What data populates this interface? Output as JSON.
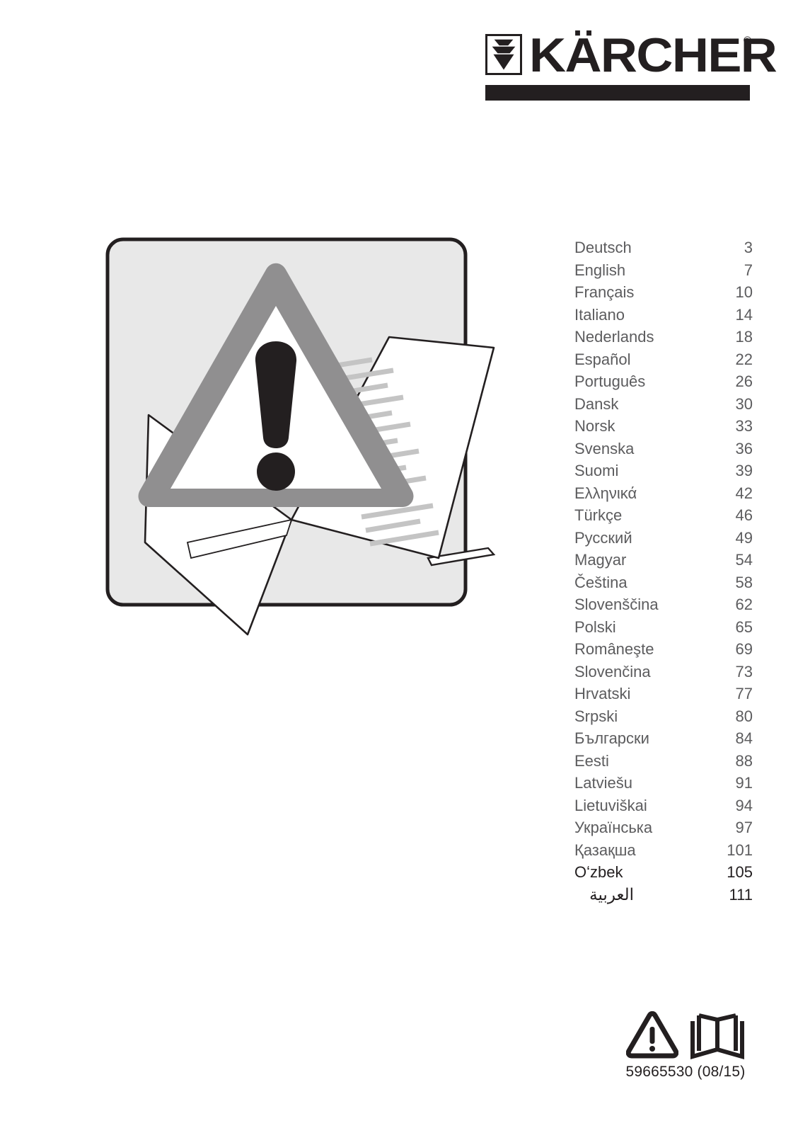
{
  "brand": {
    "wordmark": "KÄRCHER",
    "registered_symbol": "®",
    "logo_icon": "karcher-chevron-mark"
  },
  "illustration": {
    "name": "warning-triangle-over-manual",
    "description": "Grey warning triangle with exclamation mark overlapping an open instruction manual inside a rounded light-grey panel",
    "colors": {
      "panel_background": "#e8e8e8",
      "panel_border": "#231f20",
      "triangle": "#908f90",
      "exclamation": "#231f20",
      "page_white": "#ffffff",
      "text_lines": "#c4c4c4"
    }
  },
  "languages": [
    {
      "name": "Deutsch",
      "page": "3",
      "emphasis": false,
      "rtl": false
    },
    {
      "name": "English",
      "page": "7",
      "emphasis": false,
      "rtl": false
    },
    {
      "name": "Français",
      "page": "10",
      "emphasis": false,
      "rtl": false
    },
    {
      "name": "Italiano",
      "page": "14",
      "emphasis": false,
      "rtl": false
    },
    {
      "name": "Nederlands",
      "page": "18",
      "emphasis": false,
      "rtl": false
    },
    {
      "name": "Español",
      "page": "22",
      "emphasis": false,
      "rtl": false
    },
    {
      "name": "Português",
      "page": "26",
      "emphasis": false,
      "rtl": false
    },
    {
      "name": "Dansk",
      "page": "30",
      "emphasis": false,
      "rtl": false
    },
    {
      "name": "Norsk",
      "page": "33",
      "emphasis": false,
      "rtl": false
    },
    {
      "name": "Svenska",
      "page": "36",
      "emphasis": false,
      "rtl": false
    },
    {
      "name": "Suomi",
      "page": "39",
      "emphasis": false,
      "rtl": false
    },
    {
      "name": "Ελληνικά",
      "page": "42",
      "emphasis": false,
      "rtl": false
    },
    {
      "name": "Türkçe",
      "page": "46",
      "emphasis": false,
      "rtl": false
    },
    {
      "name": "Русский",
      "page": "49",
      "emphasis": false,
      "rtl": false
    },
    {
      "name": "Magyar",
      "page": "54",
      "emphasis": false,
      "rtl": false
    },
    {
      "name": "Čeština",
      "page": "58",
      "emphasis": false,
      "rtl": false
    },
    {
      "name": "Slovenščina",
      "page": "62",
      "emphasis": false,
      "rtl": false
    },
    {
      "name": "Polski",
      "page": "65",
      "emphasis": false,
      "rtl": false
    },
    {
      "name": "Româneşte",
      "page": "69",
      "emphasis": false,
      "rtl": false
    },
    {
      "name": "Slovenčina",
      "page": "73",
      "emphasis": false,
      "rtl": false
    },
    {
      "name": "Hrvatski",
      "page": "77",
      "emphasis": false,
      "rtl": false
    },
    {
      "name": "Srpski",
      "page": "80",
      "emphasis": false,
      "rtl": false
    },
    {
      "name": "Български",
      "page": "84",
      "emphasis": false,
      "rtl": false
    },
    {
      "name": "Eesti",
      "page": "88",
      "emphasis": false,
      "rtl": false
    },
    {
      "name": "Latviešu",
      "page": "91",
      "emphasis": false,
      "rtl": false
    },
    {
      "name": "Lietuviškai",
      "page": "94",
      "emphasis": false,
      "rtl": false
    },
    {
      "name": "Українська",
      "page": "97",
      "emphasis": false,
      "rtl": false
    },
    {
      "name": "Қазақша",
      "page": "101",
      "emphasis": false,
      "rtl": false
    },
    {
      "name": "Oʻzbek",
      "page": "105",
      "emphasis": true,
      "rtl": false
    },
    {
      "name": "العربية",
      "page": "111",
      "emphasis": true,
      "rtl": true
    }
  ],
  "footer": {
    "warning_icon": "warning-triangle-icon",
    "manual_icon": "open-book-icon",
    "part_number": "59665530  (08/15)"
  }
}
